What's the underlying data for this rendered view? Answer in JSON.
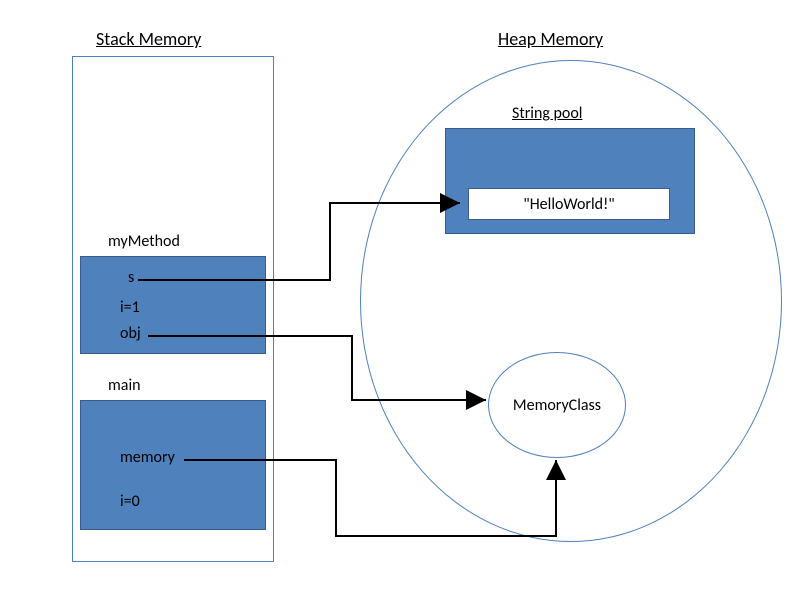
{
  "titles": {
    "stack": "Stack Memory",
    "heap": "Heap Memory",
    "stringPool": "String pool"
  },
  "stack": {
    "myMethod": {
      "header": "myMethod",
      "vars": {
        "s": "s",
        "i": "i=1",
        "obj": "obj"
      }
    },
    "main": {
      "header": "main",
      "vars": {
        "memory": "memory",
        "i": "i=0"
      }
    }
  },
  "heap": {
    "stringPool": {
      "value": "\"HelloWorld!\""
    },
    "memoryClass": "MemoryClass"
  },
  "colors": {
    "blue": "#4f81bd",
    "blueBorder": "#385d8a"
  }
}
